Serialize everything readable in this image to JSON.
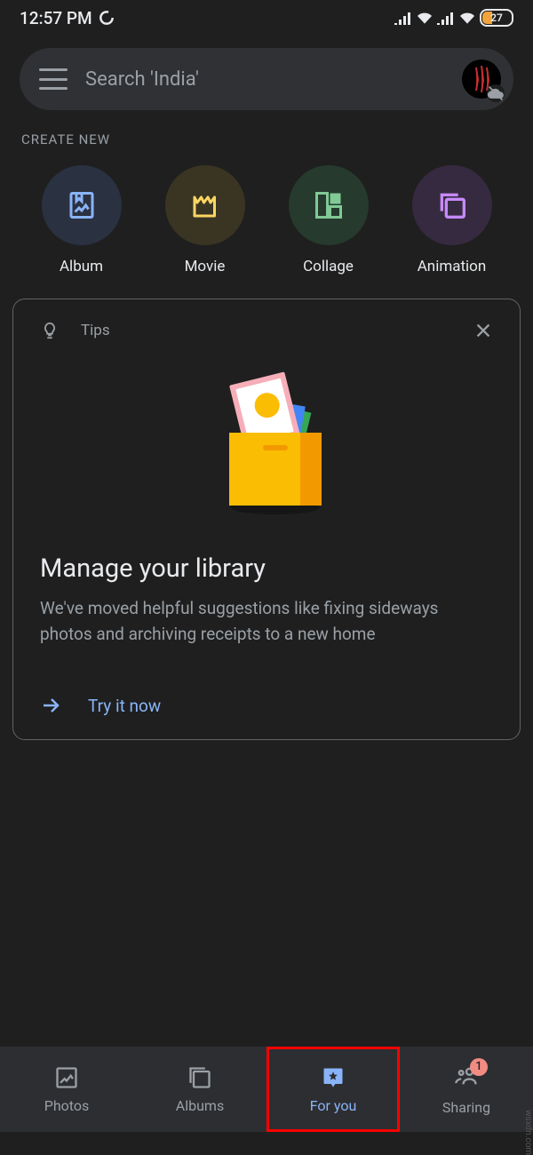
{
  "status": {
    "time": "12:57 PM",
    "battery": "27"
  },
  "search": {
    "placeholder": "Search 'India'"
  },
  "sections": {
    "create_new": "CREATE NEW"
  },
  "create": [
    {
      "label": "Album",
      "bg": "#2a3140",
      "icon": "album",
      "fg": "#8ab4f8"
    },
    {
      "label": "Movie",
      "bg": "#3a3523",
      "icon": "movie",
      "fg": "#fdd663"
    },
    {
      "label": "Collage",
      "bg": "#263a2d",
      "icon": "collage",
      "fg": "#81c995"
    },
    {
      "label": "Animation",
      "bg": "#362a40",
      "icon": "animation",
      "fg": "#c58af9"
    }
  ],
  "card": {
    "tag": "Tips",
    "title": "Manage your library",
    "desc": "We've moved helpful suggestions like fixing sideways photos and archiving receipts to a new home",
    "cta": "Try it now"
  },
  "nav": [
    {
      "label": "Photos",
      "active": false
    },
    {
      "label": "Albums",
      "active": false
    },
    {
      "label": "For you",
      "active": true
    },
    {
      "label": "Sharing",
      "active": false,
      "badge": "1"
    }
  ],
  "watermark": "wsxdn.com"
}
